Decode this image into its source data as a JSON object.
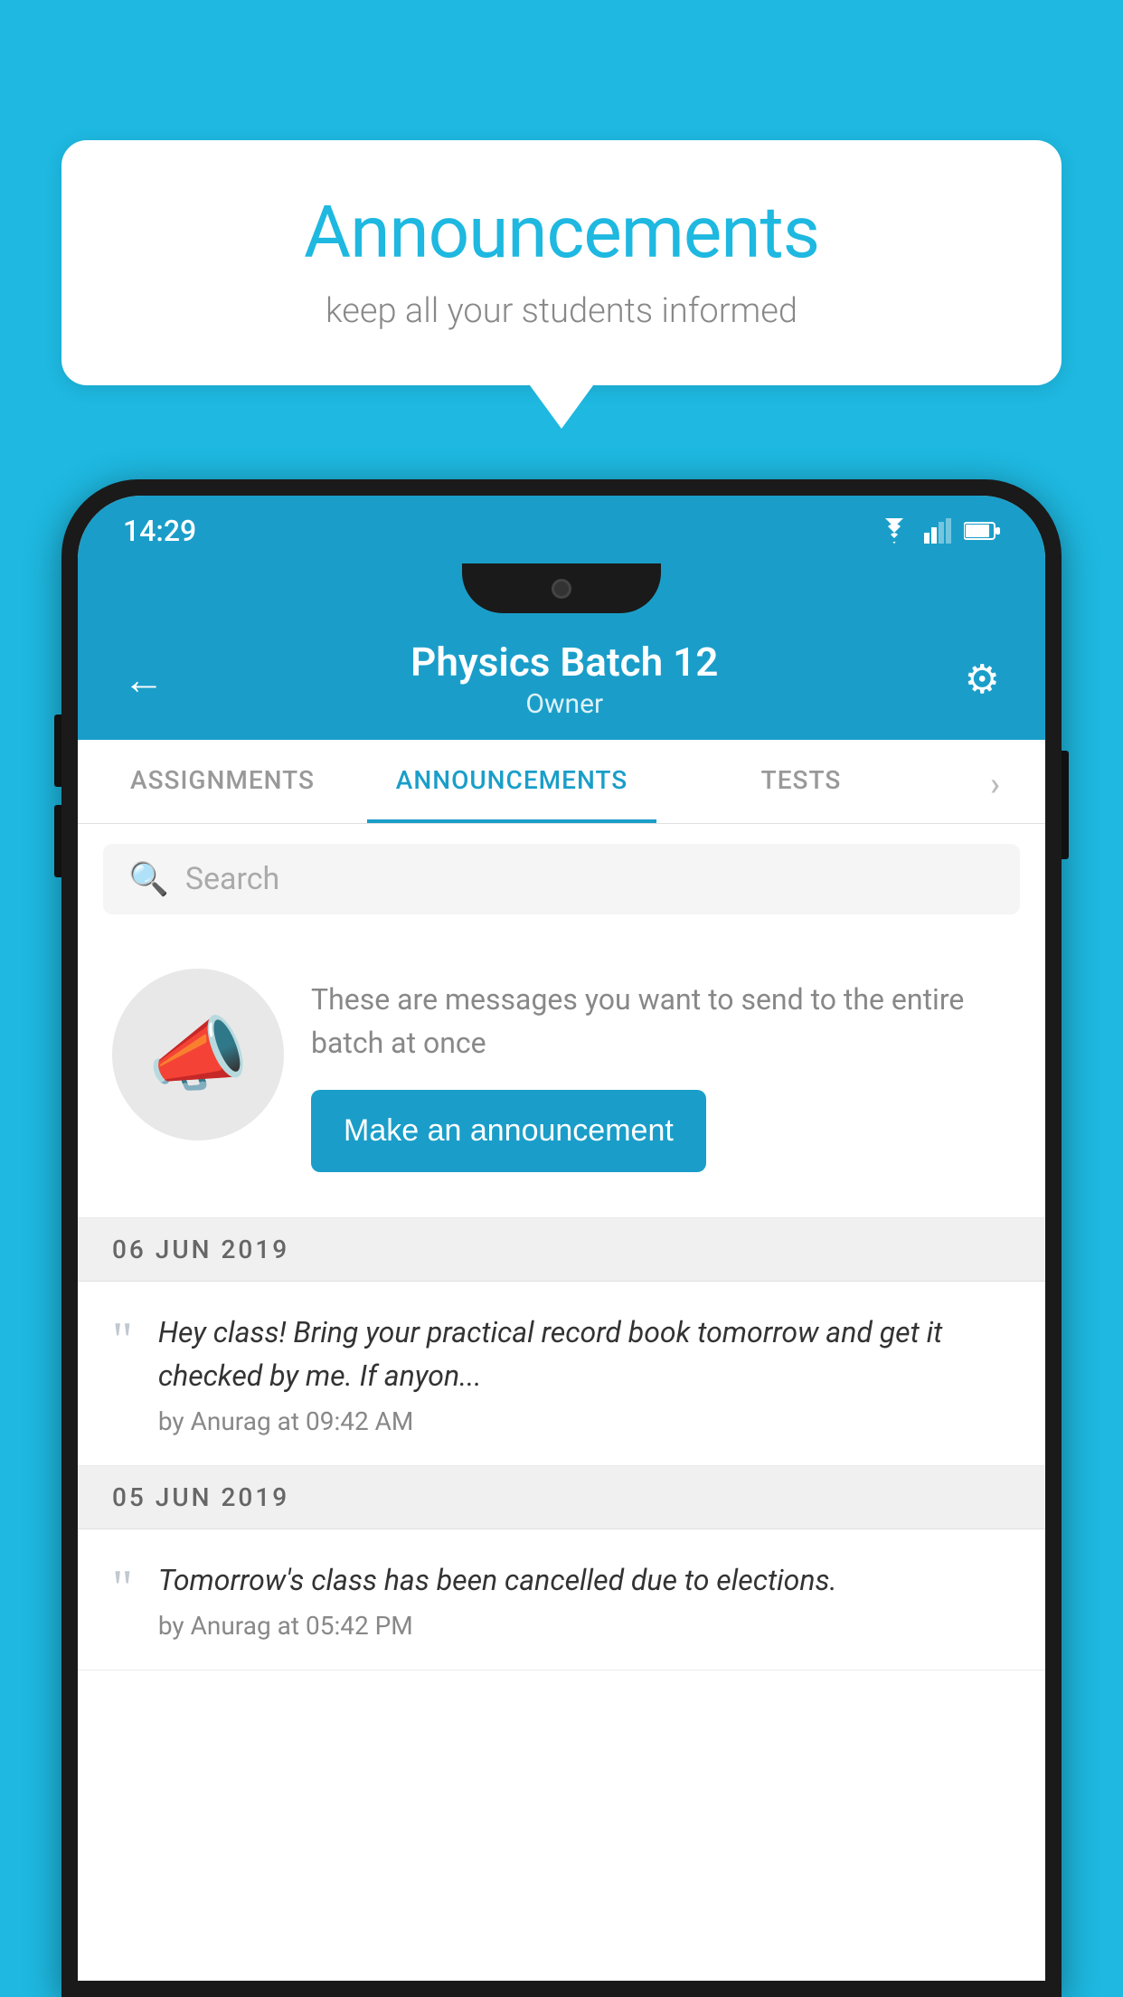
{
  "background_color": "#1eb8e0",
  "speech_bubble": {
    "title": "Announcements",
    "subtitle": "keep all your students informed"
  },
  "phone": {
    "status_bar": {
      "time": "14:29",
      "icons": [
        "wifi",
        "signal",
        "battery"
      ]
    },
    "header": {
      "title": "Physics Batch 12",
      "subtitle": "Owner",
      "back_label": "←",
      "settings_label": "⚙"
    },
    "tabs": [
      {
        "label": "ASSIGNMENTS",
        "active": false
      },
      {
        "label": "ANNOUNCEMENTS",
        "active": true
      },
      {
        "label": "TESTS",
        "active": false
      },
      {
        "label": "›",
        "active": false
      }
    ],
    "search": {
      "placeholder": "Search"
    },
    "promo": {
      "description": "These are messages you want to send to the entire batch at once",
      "button_label": "Make an announcement"
    },
    "announcements": [
      {
        "date": "06  JUN  2019",
        "text": "Hey class! Bring your practical record book tomorrow and get it checked by me. If anyon...",
        "meta": "by Anurag at 09:42 AM"
      },
      {
        "date": "05  JUN  2019",
        "text": "Tomorrow's class has been cancelled due to elections.",
        "meta": "by Anurag at 05:42 PM"
      }
    ]
  }
}
